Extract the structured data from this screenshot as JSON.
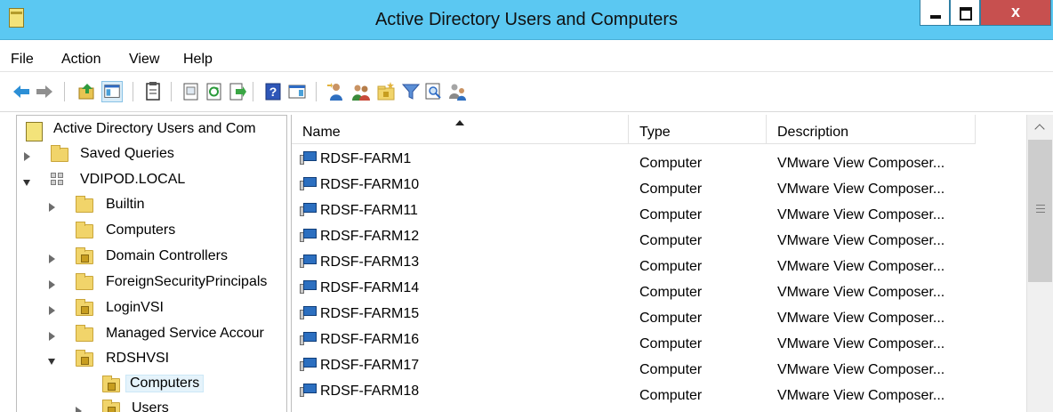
{
  "window": {
    "title": "Active Directory Users and Computers",
    "close_glyph": "x"
  },
  "menu": [
    "File",
    "Action",
    "View",
    "Help"
  ],
  "toolbar": {
    "icons": [
      "back-arrow-icon",
      "forward-arrow-icon",
      "up-folder-icon",
      "show-console-tree-icon",
      "properties-icon",
      "export-list-icon",
      "refresh-icon",
      "export-icon",
      "help-icon",
      "action-pane-icon",
      "new-user-icon",
      "new-group-icon",
      "new-ou-icon",
      "filter-icon",
      "find-icon",
      "delegate-control-icon"
    ]
  },
  "tree": {
    "root": "Active Directory Users and Com",
    "items": [
      {
        "label": "Saved Queries"
      },
      {
        "label": "VDIPOD.LOCAL"
      },
      {
        "label": "Builtin"
      },
      {
        "label": "Computers"
      },
      {
        "label": "Domain Controllers"
      },
      {
        "label": "ForeignSecurityPrincipals"
      },
      {
        "label": "LoginVSI"
      },
      {
        "label": "Managed Service Accour"
      },
      {
        "label": "RDSHVSI"
      },
      {
        "label": "Computers"
      },
      {
        "label": "Users"
      }
    ],
    "selected": "Computers"
  },
  "list": {
    "columns": [
      "Name",
      "Type",
      "Description"
    ],
    "sort_column": "Name",
    "rows": [
      {
        "name": "RDSF-FARM1",
        "type": "Computer",
        "description": "VMware View Composer..."
      },
      {
        "name": "RDSF-FARM10",
        "type": "Computer",
        "description": "VMware View Composer..."
      },
      {
        "name": "RDSF-FARM11",
        "type": "Computer",
        "description": "VMware View Composer..."
      },
      {
        "name": "RDSF-FARM12",
        "type": "Computer",
        "description": "VMware View Composer..."
      },
      {
        "name": "RDSF-FARM13",
        "type": "Computer",
        "description": "VMware View Composer..."
      },
      {
        "name": "RDSF-FARM14",
        "type": "Computer",
        "description": "VMware View Composer..."
      },
      {
        "name": "RDSF-FARM15",
        "type": "Computer",
        "description": "VMware View Composer..."
      },
      {
        "name": "RDSF-FARM16",
        "type": "Computer",
        "description": "VMware View Composer..."
      },
      {
        "name": "RDSF-FARM17",
        "type": "Computer",
        "description": "VMware View Composer..."
      },
      {
        "name": "RDSF-FARM18",
        "type": "Computer",
        "description": "VMware View Composer..."
      }
    ]
  },
  "colors": {
    "titlebar": "#5bc8f2",
    "close_button": "#c7504f",
    "selection": "#e5f3fb"
  }
}
